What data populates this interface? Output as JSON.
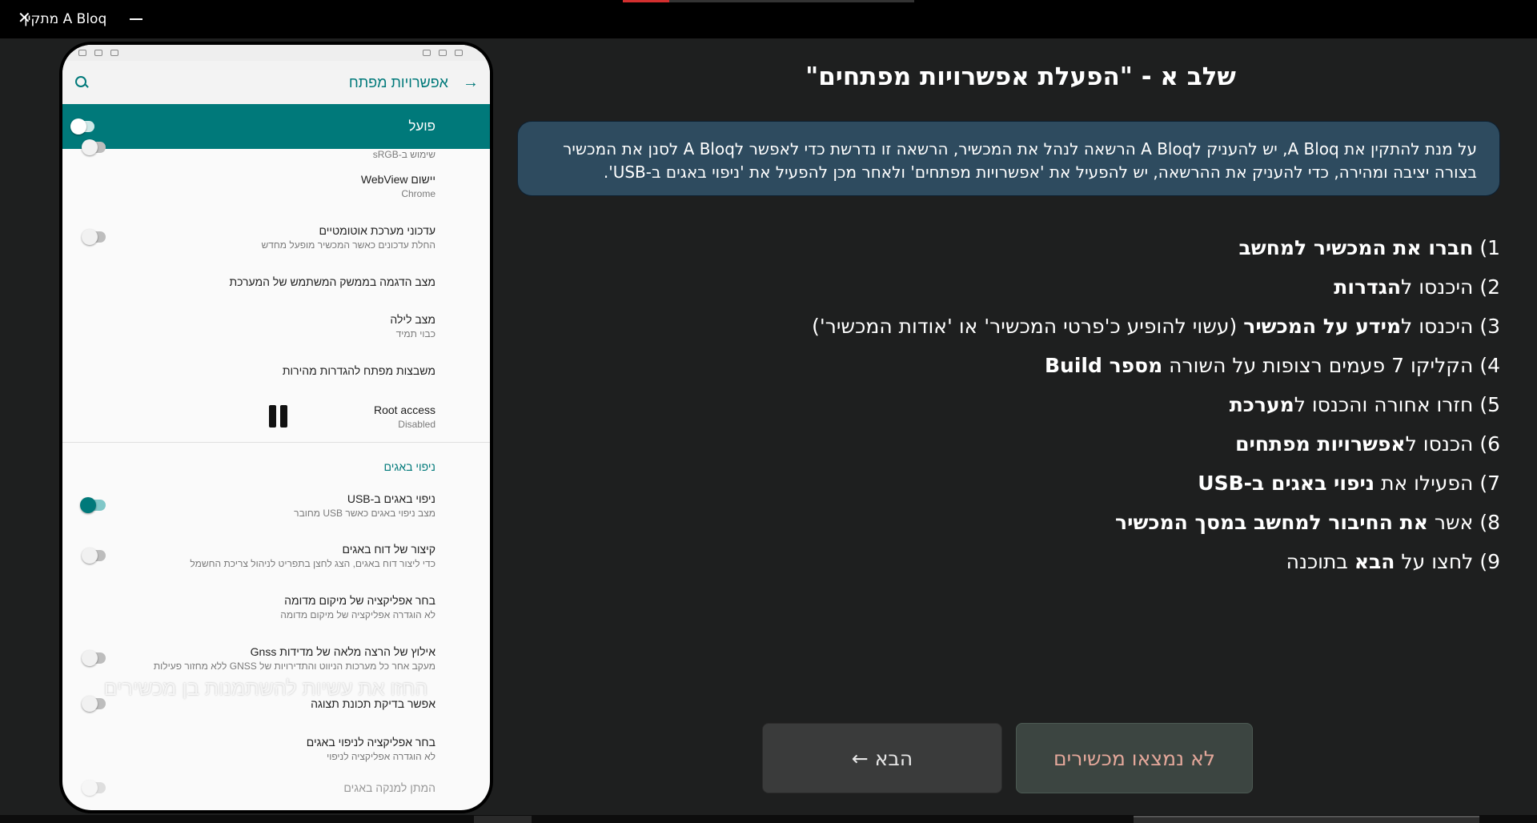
{
  "window": {
    "title": "מתקין A Bloq",
    "close_glyph": "✕",
    "progress_fraction": 0.16
  },
  "phone": {
    "appbar_title": "אפשרויות מפתח",
    "master_toggle_label": "פועל",
    "items": [
      {
        "title": "",
        "subtitle": "שימוש ב-sRGB"
      },
      {
        "title": "יישום WebView",
        "subtitle": "Chrome"
      },
      {
        "title": "עדכוני מערכת אוטומטיים",
        "subtitle": "החלת עדכונים כאשר המכשיר מופעל מחדש"
      },
      {
        "title": "מצב הדגמה בממשק המשתמש של המערכת",
        "subtitle": ""
      },
      {
        "title": "מצב לילה",
        "subtitle": "כבוי תמיד"
      },
      {
        "title": "משבצות מפתח להגדרות מהירות",
        "subtitle": ""
      },
      {
        "title": "Root access",
        "subtitle": "Disabled"
      },
      {
        "title": "ניפוי באגים ב-USB",
        "subtitle": "מצב ניפוי באגים כאשר USB מחובר"
      },
      {
        "title": "קיצור של דוח באגים",
        "subtitle": "כדי ליצור דוח באגים, הצג לחצן בתפריט לניהול צריכת החשמל"
      },
      {
        "title": "בחר אפליקציה של מיקום מדומה",
        "subtitle": "לא הוגדרה אפליקציה של מיקום מדומה"
      },
      {
        "title": "אילוץ של הרצה מלאה של מדידות Gnss",
        "subtitle": "מעקב אחר כל מערכות הניווט והתדירויות של GNSS ללא מחזור פעילות"
      },
      {
        "title": "אפשר בדיקת תכונת תצוגה",
        "subtitle": ""
      },
      {
        "title": "בחר אפליקציה לניפוי באגים",
        "subtitle": "לא הוגדרה אפליקציה לניפוי"
      },
      {
        "title": "המתן למנקה באגים",
        "subtitle": ""
      }
    ],
    "section_debugging": "ניפוי באגים",
    "watermark": "החזו את עשיות להשתמנות בן מכשירים"
  },
  "heading": "שלב א - \"הפעלת אפשרויות מפתחים\"",
  "info": "על מנת להתקין את A Bloq, יש להעניק לA Bloq הרשאה לנהל את המכשיר, הרשאה זו נדרשת כדי לאפשר לA Bloq לסנן את המכשיר בצורה יציבה ומהירה, כדי להעניק את ההרשאה, יש להפעיל את 'אפשרויות מפתחים' ולאחר מכן להפעיל את 'ניפוי באגים ב-USB'.",
  "steps": [
    {
      "pre": "1) ",
      "bold": "חברו את המכשיר למחשב",
      "post": ""
    },
    {
      "pre": "2) היכנסו ל",
      "bold": "הגדרות",
      "post": ""
    },
    {
      "pre": "3) היכנסו ל",
      "bold": "מידע על המכשיר",
      "post": " (עשוי להופיע כ'פרטי המכשיר' או 'אודות המכשיר')"
    },
    {
      "pre": "4) הקליקו 7 פעמים רצופות על השורה ",
      "bold": "מספר Build",
      "post": ""
    },
    {
      "pre": "5) חזרו אחורה והכנסו ל",
      "bold": "מערכת",
      "post": ""
    },
    {
      "pre": "6) הכנסו ל",
      "bold": "אפשרויות מפתחים",
      "post": ""
    },
    {
      "pre": "7) הפעילו את ",
      "bold": "ניפוי באגים ב-USB",
      "post": ""
    },
    {
      "pre": "8) אשר ",
      "bold": "את החיבור למחשב במסך המכשיר",
      "post": ""
    },
    {
      "pre": "9) לחצו על ",
      "bold": "הבא",
      "post": " בתוכנה"
    }
  ],
  "buttons": {
    "next": "הבא ←",
    "no_devices": "לא נמצאו מכשירים"
  },
  "colors": {
    "accent_teal": "#00797a",
    "info_box": "#2e4b5f",
    "no_devices_text": "#e3a79a"
  }
}
